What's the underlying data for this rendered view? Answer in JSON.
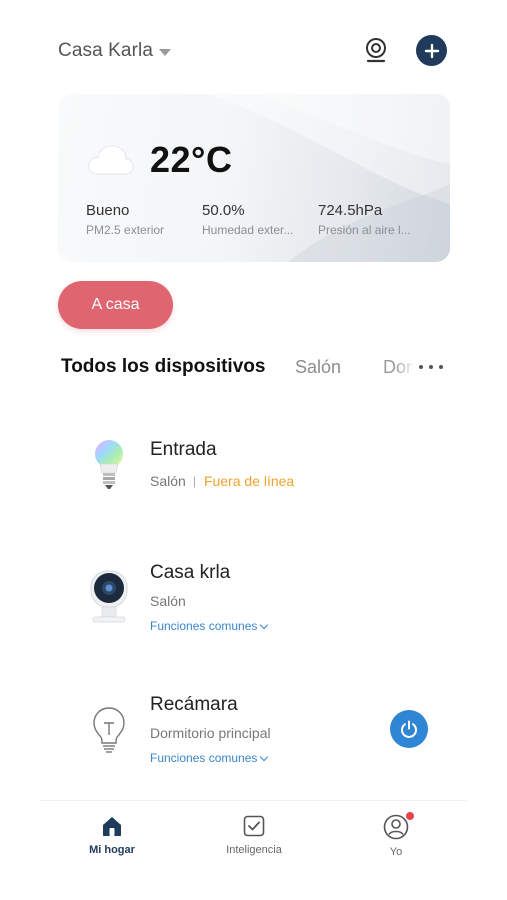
{
  "header": {
    "home_name": "Casa Karla",
    "icons": {
      "camera": "camera-icon",
      "add": "plus-icon"
    }
  },
  "weather": {
    "temperature": "22°C",
    "condition_icon": "cloud-icon",
    "stats": [
      {
        "value": "Bueno",
        "label": "PM2.5 exterior"
      },
      {
        "value": "50.0%",
        "label": "Humedad exter..."
      },
      {
        "value": "724.5hPa",
        "label": "Presión al aire l..."
      }
    ]
  },
  "scene": {
    "label": "A casa",
    "color": "#df6670"
  },
  "tabs": {
    "active": "Todos los dispositivos",
    "items": [
      "Salón",
      "Dor"
    ]
  },
  "devices": [
    {
      "name": "Entrada",
      "room": "Salón",
      "separator": "|",
      "status": "Fuera de línea",
      "icon": "rgb-bulb-icon"
    },
    {
      "name": "Casa krla",
      "room": "Salón",
      "functions_label": "Funciones comunes",
      "icon": "security-camera-icon"
    },
    {
      "name": "Recámara",
      "room": "Dormitorio principal",
      "functions_label": "Funciones comunes",
      "icon": "bulb-outline-icon",
      "power_icon": "power-icon"
    }
  ],
  "nav": {
    "items": [
      {
        "label": "Mi hogar",
        "icon": "home-icon",
        "active": true
      },
      {
        "label": "Inteligencia",
        "icon": "check-square-icon",
        "active": false
      },
      {
        "label": "Yo",
        "icon": "user-icon",
        "active": false,
        "badge": true
      }
    ]
  },
  "colors": {
    "primary_dark": "#1f3a5a",
    "offline": "#f0a22a",
    "link": "#3a86c8",
    "power": "#2f86d4",
    "badge": "#e8414a"
  }
}
